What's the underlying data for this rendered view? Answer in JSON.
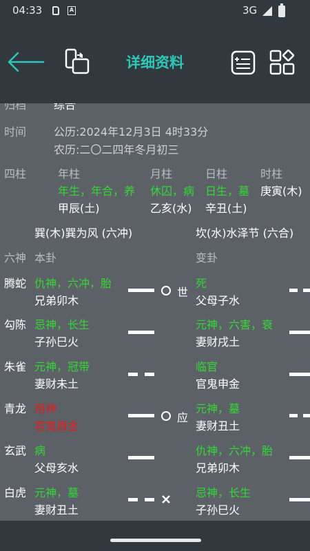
{
  "status": {
    "time": "04:33",
    "network": "3G"
  },
  "header": {
    "title": "详细资料"
  },
  "info": {
    "archive_label": "归档",
    "archive_value": "综合",
    "time_label": "时间",
    "gregorian": "公历:2024年12月3日  4时33分",
    "lunar": "农历:二〇二四年冬月初三"
  },
  "pillars": {
    "label": "四柱",
    "headers": [
      "年柱",
      "月柱",
      "日柱",
      "时柱"
    ],
    "states": [
      "年生，年合，养",
      "休囚，病",
      "日生，墓",
      ""
    ],
    "ganzhi": [
      "甲辰(土)",
      "乙亥(水)",
      "辛丑(土)",
      "庚寅(木)"
    ]
  },
  "hexagrams": {
    "main_name": "巽(木)巽为风 (六冲)",
    "changed_name": "坎(水)水泽节 (六合)"
  },
  "columns": {
    "six_gods": "六神",
    "main": "本卦",
    "changed": "变卦"
  },
  "lines": [
    {
      "god": "腾蛇",
      "main_state": "仇神，六冲，胎",
      "main_name": "兄弟卯木",
      "marker": "世",
      "changed_state": "死",
      "changed_name": "父母子水"
    },
    {
      "god": "勾陈",
      "main_state": "忌神，长生",
      "main_name": "子孙巳火",
      "marker": "",
      "changed_state": "元神，六害，衰",
      "changed_name": "妻财戌土"
    },
    {
      "god": "朱雀",
      "main_state": "元神，冠带",
      "main_name": "妻财未土",
      "marker": "",
      "changed_state": "临官",
      "changed_name": "官鬼申金"
    },
    {
      "god": "青龙",
      "main_state": "用神",
      "main_name": "官鬼酉金",
      "marker": "应",
      "changed_state": "元神，墓",
      "changed_name": "妻财丑土"
    },
    {
      "god": "玄武",
      "main_state": "病",
      "main_name": "父母亥水",
      "marker": "",
      "changed_state": "仇神，六冲，胎",
      "changed_name": "兄弟卯木"
    },
    {
      "god": "白虎",
      "main_state": "元神，墓",
      "main_name": "妻财丑土",
      "marker": "",
      "changed_state": "忌神，长生",
      "changed_name": "子孙巳火"
    }
  ],
  "colors": {
    "accent": "#2ec6b7",
    "good": "#33d933",
    "bad": "#e0201f",
    "bar": "#31393f",
    "bg": "#5c6167"
  }
}
